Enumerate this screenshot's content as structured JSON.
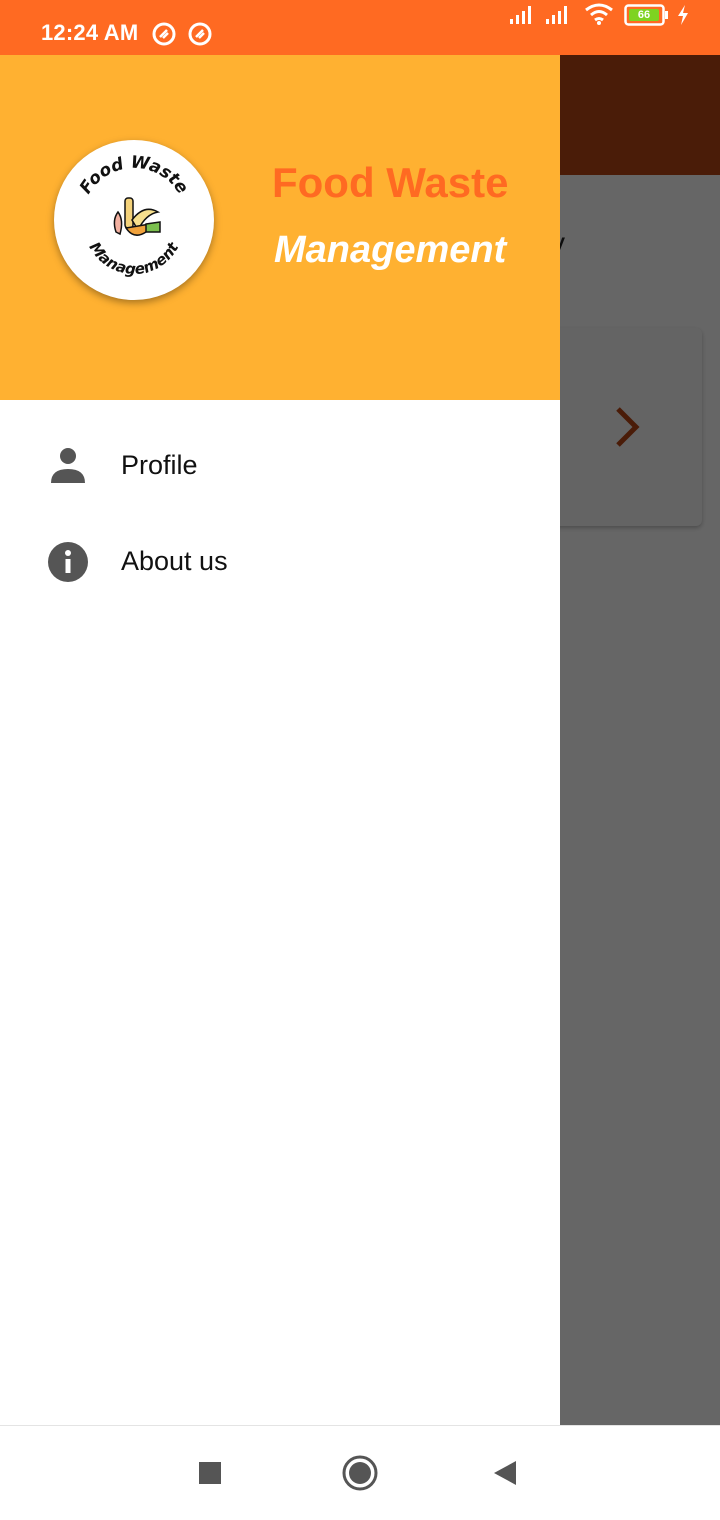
{
  "status_bar": {
    "time": "12:24 AM",
    "battery": "66",
    "icons": [
      "app-notification-icon",
      "app-notification-icon",
      "signal-icon",
      "signal-icon",
      "wifi-icon",
      "battery-icon",
      "charging-icon"
    ],
    "color": "#ff6a22"
  },
  "background_app": {
    "subtitle_fragment": "ry",
    "card_icon": "chevron-right-icon",
    "appbar_color": "#b84614"
  },
  "drawer": {
    "header": {
      "title": "Food Waste",
      "subtitle": "Management",
      "logo_text_top": "Food Waste",
      "logo_text_bottom": "Management",
      "background": "#ffb131",
      "title_color": "#ff6a22"
    },
    "items": [
      {
        "label": "Profile",
        "icon": "person-icon"
      },
      {
        "label": "About us",
        "icon": "info-icon"
      }
    ]
  },
  "nav_bar": {
    "buttons": [
      "recents-button",
      "home-button",
      "back-button"
    ]
  }
}
